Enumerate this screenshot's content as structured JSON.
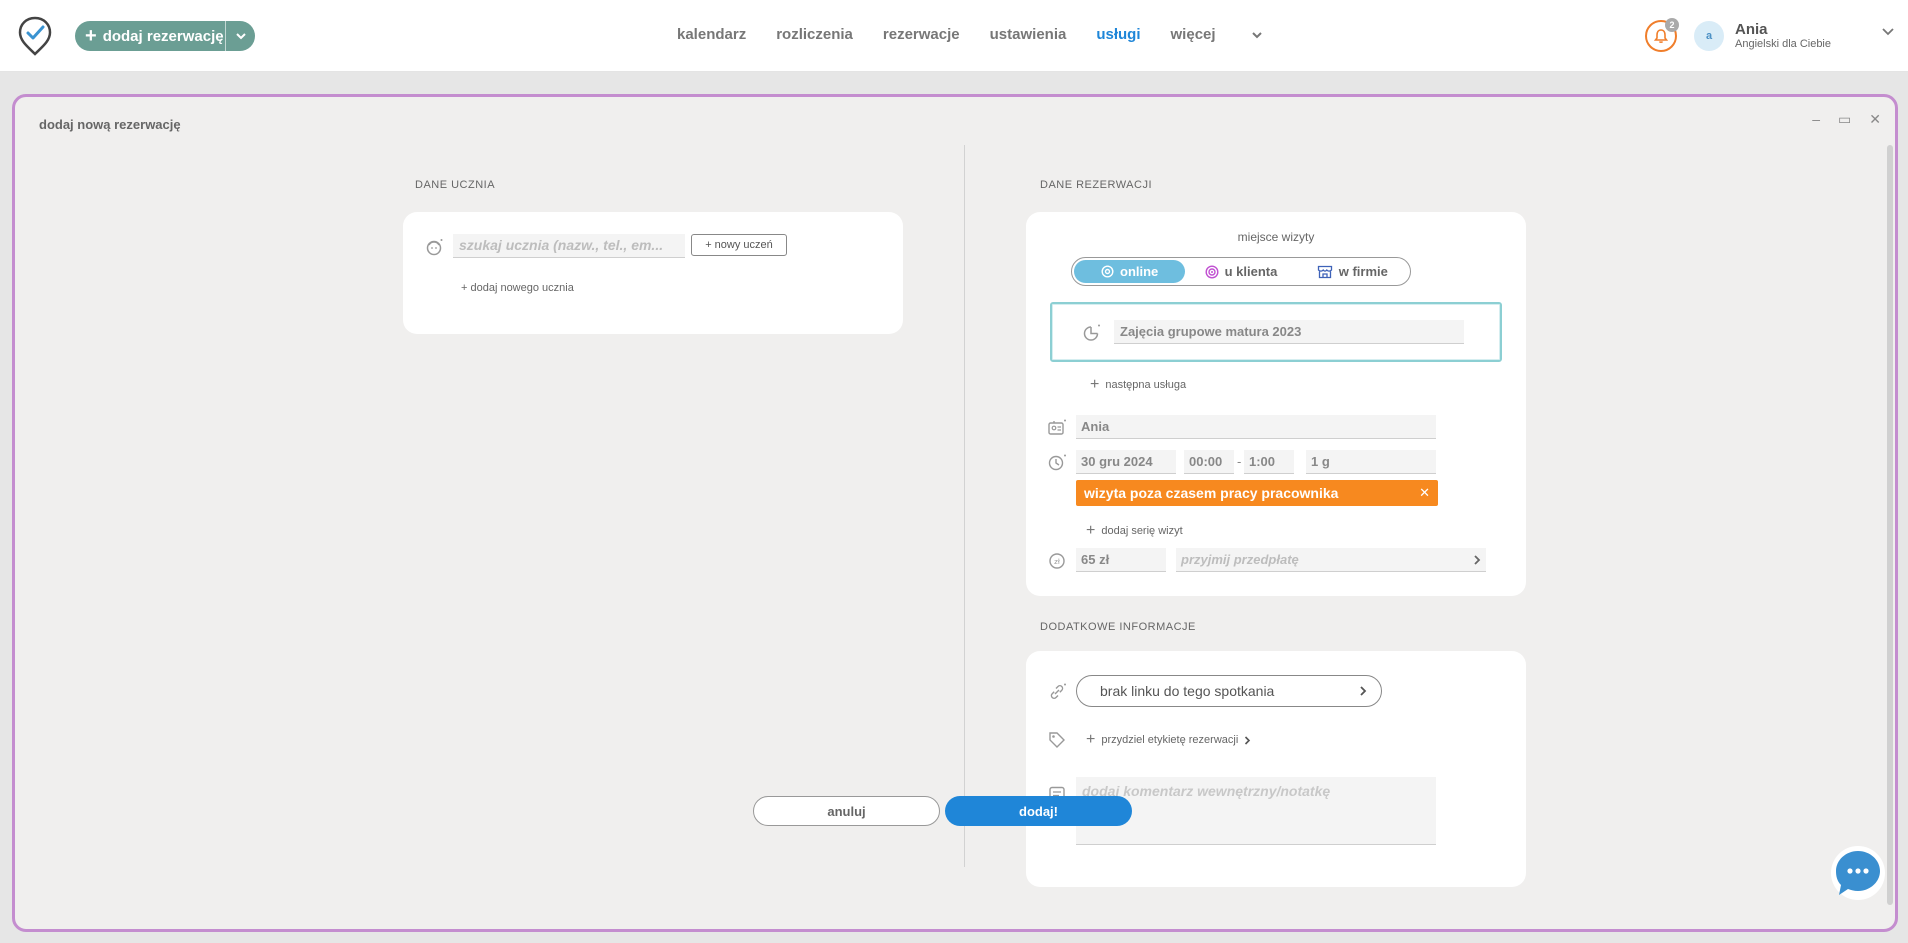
{
  "topbar": {
    "add_booking_label": "dodaj rezerwację",
    "nav": [
      {
        "label": "kalendarz",
        "active": false
      },
      {
        "label": "rozliczenia",
        "active": false
      },
      {
        "label": "rezerwacje",
        "active": false
      },
      {
        "label": "ustawienia",
        "active": false
      },
      {
        "label": "usługi",
        "active": true
      }
    ],
    "more_label": "więcej",
    "notifications_count": "2",
    "user": {
      "initial": "a",
      "name": "Ania",
      "company": "Angielski dla Ciebie"
    }
  },
  "modal": {
    "title": "dodaj nową rezerwację",
    "student_section": {
      "label": "DANE UCZNIA",
      "search_placeholder": "szukaj ucznia (nazw., tel., em...",
      "new_student_button": "+ nowy uczeń",
      "add_new_student_link": "+ dodaj nowego ucznia"
    },
    "reservation_section": {
      "label": "DANE REZERWACJI",
      "place_label": "miejsce wizyty",
      "place_options": [
        {
          "label": "online",
          "selected": true
        },
        {
          "label": "u klienta",
          "selected": false
        },
        {
          "label": "w firmie",
          "selected": false
        }
      ],
      "service_value": "Zajęcia  grupowe matura 2023",
      "next_service_link": "następna usługa",
      "employee": "Ania",
      "date": "30 gru 2024",
      "time_from": "00:00",
      "time_to": "1:00",
      "duration": "1 g",
      "warning": "wizyta poza czasem pracy pracownika",
      "add_series_link": "dodaj serię wizyt",
      "price": "65 zł",
      "prepaid_placeholder": "przyjmij przedpłatę"
    },
    "extra_section": {
      "label": "DODATKOWE INFORMACJE",
      "meeting_link_button": "brak linku do tego spotkania",
      "tag_link": "przydziel etykietę rezerwacji",
      "comment_placeholder": "dodaj komentarz wewnętrzny/notatkę"
    },
    "cancel_button": "anuluj",
    "submit_button": "dodaj!"
  },
  "colors": {
    "accent": "#1f86d8",
    "brand_green": "#6b9e94",
    "modal_border": "#c48dcf",
    "warning": "#f7891f",
    "online_selected": "#6ebedf",
    "bell": "#f07e2b"
  }
}
